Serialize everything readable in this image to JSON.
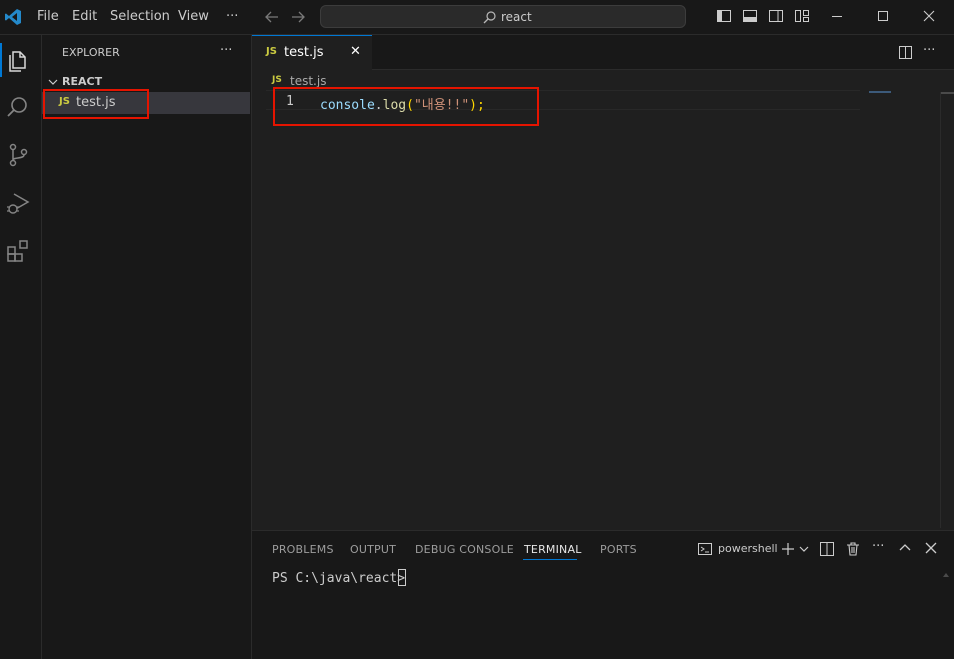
{
  "titlebar": {
    "menus": [
      "File",
      "Edit",
      "Selection",
      "View",
      "···"
    ],
    "search_text": "react"
  },
  "sidebar": {
    "title": "EXPLORER",
    "more": "···",
    "folder": "REACT",
    "files": [
      {
        "icon_label": "JS",
        "name": "test.js"
      }
    ]
  },
  "editor": {
    "tab": {
      "icon_label": "JS",
      "name": "test.js",
      "close": "✕"
    },
    "breadcrumb": {
      "icon_label": "JS",
      "name": "test.js"
    },
    "lines": [
      {
        "number": "1",
        "obj": "console",
        "dot": ".",
        "method": "log",
        "open": "(",
        "string": "\"내용!!\"",
        "close": ");"
      }
    ]
  },
  "panel": {
    "tabs": [
      "PROBLEMS",
      "OUTPUT",
      "DEBUG CONSOLE",
      "TERMINAL",
      "PORTS"
    ],
    "active_tab": "TERMINAL",
    "shell": "powershell",
    "prompt": "PS C:\\java\\react> "
  },
  "colors": {
    "accent": "#0078d4",
    "js_icon": "#cbcb41",
    "highlight_box": "#e51400",
    "string": "#ce9178",
    "identifier": "#9cdcfe",
    "function": "#dcdcaa"
  }
}
